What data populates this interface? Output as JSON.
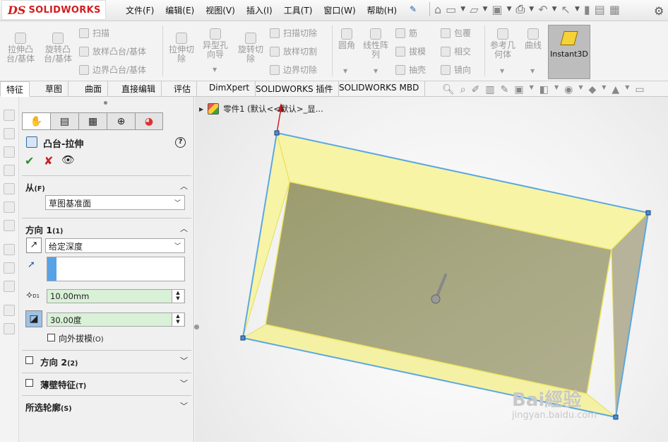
{
  "app": {
    "logo_ds": "DS",
    "logo_name": "SOLIDWORKS"
  },
  "menu": [
    "文件(F)",
    "编辑(E)",
    "视图(V)",
    "插入(I)",
    "工具(T)",
    "窗口(W)",
    "帮助(H)"
  ],
  "ribbon": {
    "boss_extrude": "拉伸凸台/基体",
    "boss_revolve": "旋转凸台/基体",
    "sweep": "扫描",
    "loft": "放样凸台/基体",
    "boundary_boss": "边界凸台/基体",
    "cut_extrude": "拉伸切除",
    "hole_wizard": "异型孔向导",
    "cut_revolve": "旋转切除",
    "swept_cut": "扫描切除",
    "lofted_cut": "放样切割",
    "boundary_cut": "边界切除",
    "fillet": "圆角",
    "linear_pattern": "线性阵列",
    "rib": "筋",
    "draft": "拔模",
    "shell": "抽壳",
    "wrap": "包覆",
    "intersect": "相交",
    "mirror": "镜向",
    "reference_geometry": "参考几何体",
    "curves": "曲线",
    "instant3d": "Instant3D"
  },
  "tabs": [
    "特征",
    "草图",
    "曲面",
    "直接编辑",
    "评估",
    "DimXpert",
    "SOLIDWORKS 插件",
    "SOLIDWORKS MBD"
  ],
  "tree": {
    "part_label": "零件1 (默认<<默认>_显..."
  },
  "property_manager": {
    "title": "凸台-拉伸",
    "help": "?",
    "from_label": "从",
    "from_key": "(F)",
    "from_value": "草图基准面",
    "dir1_label": "方向 1",
    "dir1_key": "(1)",
    "end_condition": "给定深度",
    "depth": "10.00mm",
    "draft_angle": "30.00度",
    "draft_outward": "向外拔模",
    "draft_outward_key": "(O)",
    "dir2_label": "方向 2",
    "dir2_key": "(2)",
    "thin_label": "薄壁特征",
    "thin_key": "(T)",
    "contours_label": "所选轮廓",
    "contours_key": "(S)"
  },
  "watermark": {
    "brand": "Bai經验",
    "url": "jingyan.baidu.com"
  },
  "colors": {
    "face_yellow": "#f7f4a6",
    "face_top": "#a8a77d",
    "edge_blue": "#5aa8e0",
    "arrow_red": "#d02020"
  }
}
